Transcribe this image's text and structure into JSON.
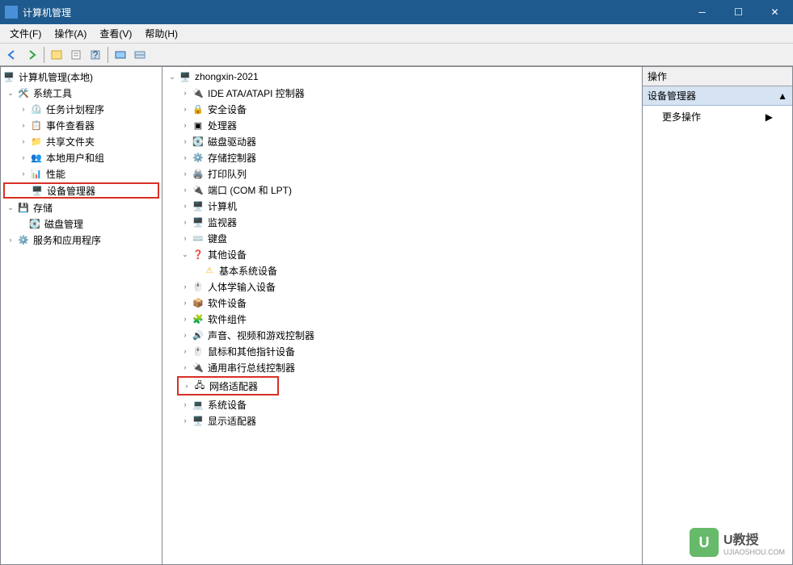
{
  "titlebar": {
    "title": "计算机管理"
  },
  "menubar": {
    "file": "文件(F)",
    "action": "操作(A)",
    "view": "查看(V)",
    "help": "帮助(H)"
  },
  "left_tree": {
    "root": "计算机管理(本地)",
    "system_tools": "系统工具",
    "task_scheduler": "任务计划程序",
    "event_viewer": "事件查看器",
    "shared_folders": "共享文件夹",
    "local_users": "本地用户和组",
    "performance": "性能",
    "device_manager": "设备管理器",
    "storage": "存储",
    "disk_mgmt": "磁盘管理",
    "services_apps": "服务和应用程序"
  },
  "center_tree": {
    "hostname": "zhongxin-2021",
    "ide": "IDE ATA/ATAPI 控制器",
    "security": "安全设备",
    "cpu": "处理器",
    "disk_drive": "磁盘驱动器",
    "storage_ctrl": "存储控制器",
    "print_queue": "打印队列",
    "ports": "端口 (COM 和 LPT)",
    "computer": "计算机",
    "monitor": "监视器",
    "keyboard": "键盘",
    "other_devices": "其他设备",
    "base_system": "基本系统设备",
    "hid": "人体学输入设备",
    "soft_devices": "软件设备",
    "soft_components": "软件组件",
    "audio": "声音、视频和游戏控制器",
    "mouse": "鼠标和其他指针设备",
    "usb": "通用串行总线控制器",
    "network": "网络适配器",
    "system_devices": "系统设备",
    "display": "显示适配器"
  },
  "right_panel": {
    "header": "操作",
    "section": "设备管理器",
    "more": "更多操作"
  },
  "watermark": {
    "cn": "U教授",
    "en": "UJIAOSHOU.COM",
    "badge": "U"
  }
}
